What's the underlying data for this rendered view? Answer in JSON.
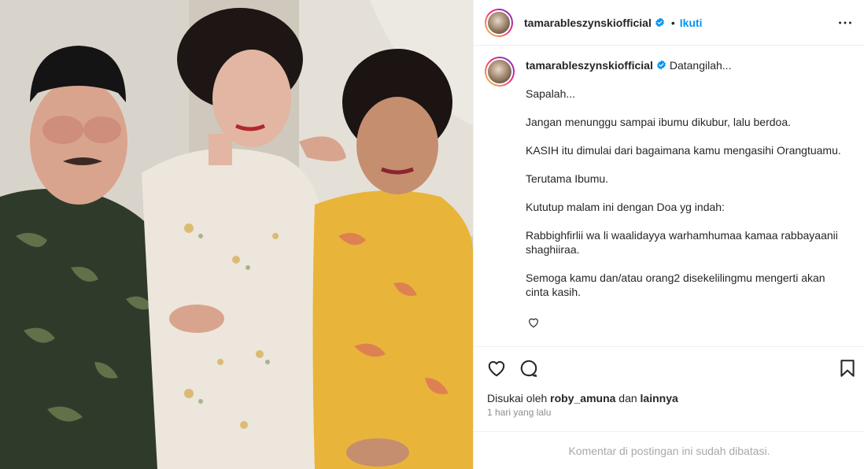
{
  "post": {
    "username": "tamarableszynskiofficial",
    "follow_label": "Ikuti",
    "separator": "•"
  },
  "caption": {
    "username": "tamarableszynskiofficial",
    "greeting": "Datangilah...",
    "paragraphs": [
      "Sapalah...",
      "Jangan menunggu sampai ibumu dikubur, lalu berdoa.",
      "KASIH itu dimulai dari bagaimana kamu mengasihi Orangtuamu.",
      "Terutama Ibumu.",
      "Kututup malam ini dengan Doa yg indah:",
      "Rabbighfirlii wa li waalidayya warhamhumaa kamaa rabbayaanii shaghiiraa.",
      "Semoga kamu dan/atau orang2 disekelilingmu mengerti akan cinta kasih."
    ]
  },
  "engagement": {
    "liked_by_prefix": "Disukai oleh",
    "liked_by_user": "roby_amuna",
    "and_label": "dan",
    "others_label": "lainnya",
    "time_ago": "1 hari yang lalu"
  },
  "comments": {
    "limited_notice": "Komentar di postingan ini sudah dibatasi."
  },
  "colors": {
    "accent_blue": "#0095f6",
    "verified_blue": "#0095f6",
    "muted_text": "#8e8e8e",
    "border": "#efefef"
  },
  "icons": [
    "more-options-icon",
    "verified-badge-icon",
    "like-heart-icon",
    "comment-icon",
    "save-bookmark-icon",
    "caption-like-heart-icon"
  ]
}
